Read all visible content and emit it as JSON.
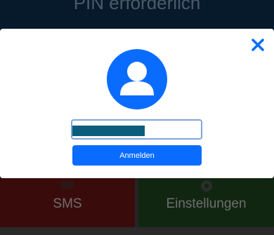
{
  "background": {
    "header_title": "PIN erforderlich",
    "tiles": [
      {
        "label": "SMS",
        "icon": "message-icon"
      },
      {
        "label": "Einstellungen",
        "icon": "gear-icon"
      }
    ]
  },
  "modal": {
    "close_icon": "close-icon",
    "avatar_icon": "user-icon",
    "pin_value": "",
    "login_label": "Anmelden"
  },
  "colors": {
    "accent": "#0a6cff",
    "sms_tile": "#3a0b0b",
    "settings_tile": "#112611"
  }
}
